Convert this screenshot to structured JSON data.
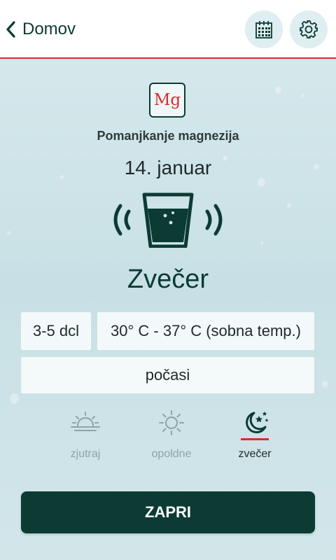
{
  "header": {
    "back_label": "Domov"
  },
  "reminder": {
    "mineral_symbol": "Mg",
    "condition": "Pomanjkanje magnezija",
    "date": "14. januar",
    "period": "Zvečer",
    "amount": "3-5 dcl",
    "temperature": "30° C - 37° C (sobna temp.)",
    "drinking_speed": "počasi"
  },
  "times_of_day": [
    {
      "label": "zjutraj",
      "icon": "sunrise-icon",
      "active": false
    },
    {
      "label": "opoldne",
      "icon": "sun-icon",
      "active": false
    },
    {
      "label": "zvečer",
      "icon": "moon-stars-icon",
      "active": true
    }
  ],
  "close_label": "ZAPRI",
  "colors": {
    "primary": "#0b3b33",
    "accent": "#d32f2f",
    "muted": "#8aa5a9"
  }
}
